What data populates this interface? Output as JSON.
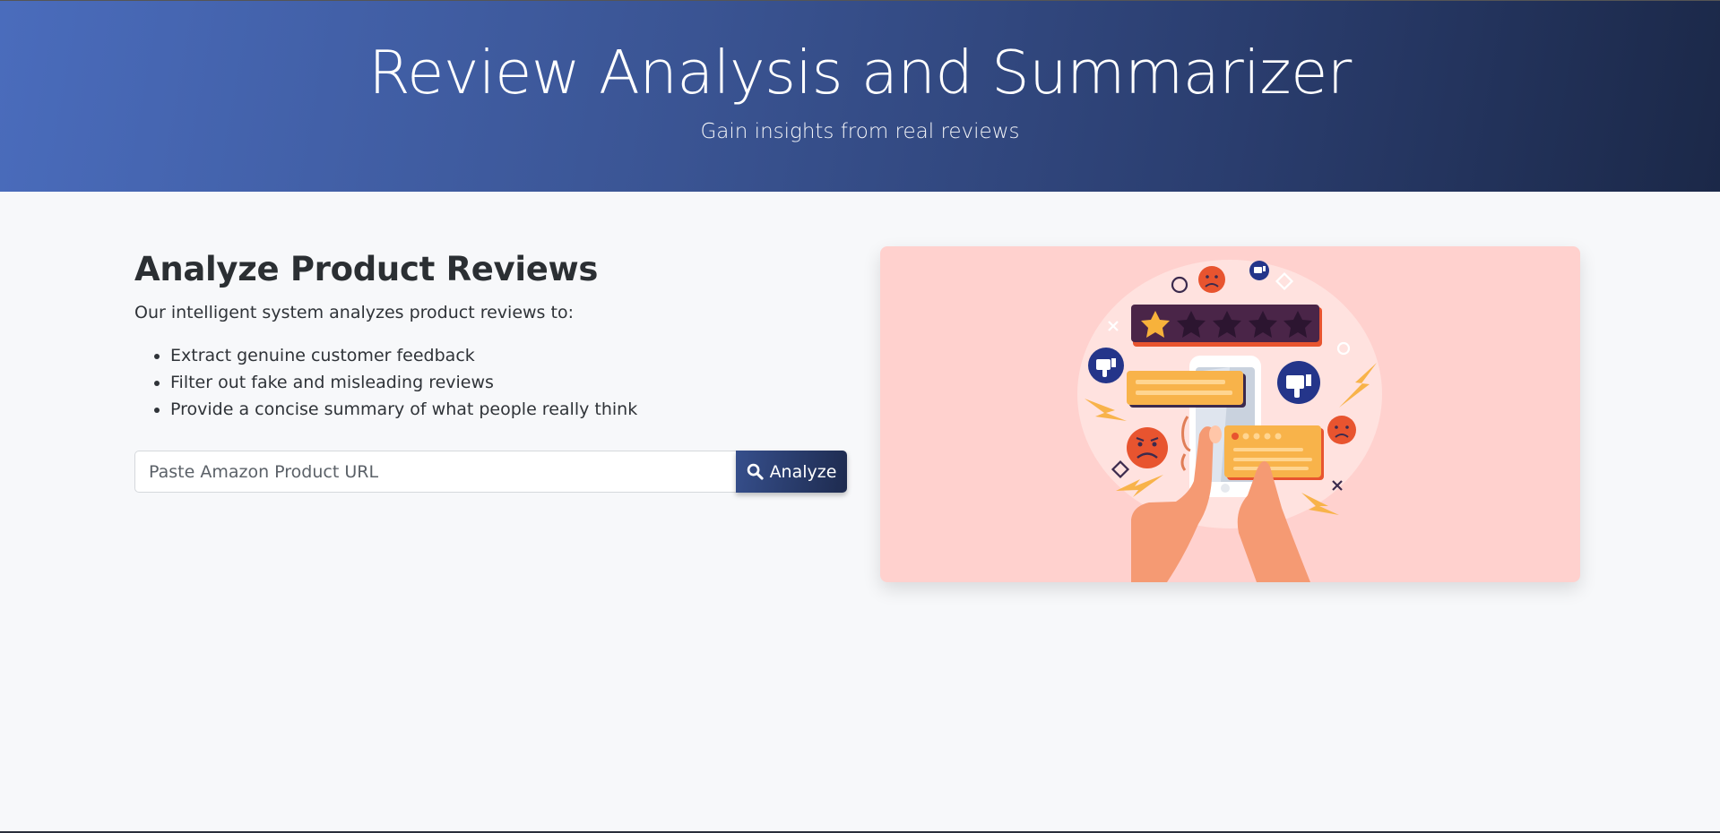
{
  "hero": {
    "title": "Review Analysis and Summarizer",
    "subtitle": "Gain insights from real reviews"
  },
  "main": {
    "heading": "Analyze Product Reviews",
    "intro": "Our intelligent system analyzes product reviews to:",
    "features": [
      "Extract genuine customer feedback",
      "Filter out fake and misleading reviews",
      "Provide a concise summary of what people really think"
    ],
    "search": {
      "placeholder": "Paste Amazon Product URL",
      "value": "",
      "button_label": "Analyze",
      "button_icon": "search-icon"
    }
  },
  "illustration": {
    "description_icon": "bad-reviews-illustration",
    "rating_stars_filled": 1,
    "rating_stars_total": 5
  },
  "colors": {
    "hero_start": "#4a6cbc",
    "hero_end": "#1b2848",
    "button": "#2a3d6e",
    "card_bg": "#ffd1ce",
    "page_bg": "#f7f8fa"
  }
}
